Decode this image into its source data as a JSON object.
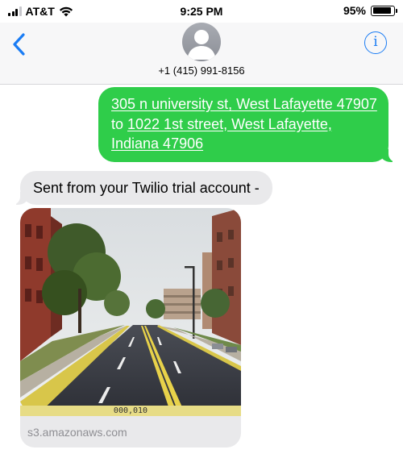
{
  "status_bar": {
    "carrier": "AT&T",
    "time": "9:25 PM",
    "battery_percent": "95%",
    "battery_level": 0.95,
    "icons": [
      "cellular-signal-icon",
      "wifi-icon",
      "battery-icon"
    ]
  },
  "header": {
    "contact_number": "+1 (415) 991-8156",
    "info_glyph": "i",
    "icons": [
      "chevron-left-icon",
      "person-avatar-icon",
      "info-icon"
    ],
    "accent_color": "#1a7cf4"
  },
  "conversation": {
    "outgoing": {
      "segments": [
        "305 n university st, West Lafayette 47907",
        " to ",
        "1022 1st street, West Lafayette, Indiana 47906"
      ],
      "bubble_color": "#2fcd4a"
    },
    "incoming_text": "Sent from your Twilio trial account -",
    "incoming_color": "#e9e9eb",
    "media": {
      "image_caption": "000,010",
      "link_domain": "s3.amazonaws.com"
    }
  }
}
